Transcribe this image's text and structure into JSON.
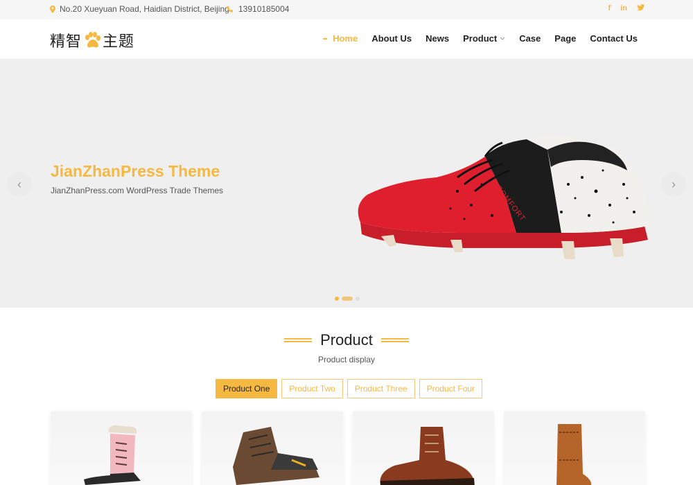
{
  "topbar": {
    "address": "No.20 Xueyuan Road, Haidian District, Beijing",
    "phone": "13910185004",
    "social": [
      "f",
      "in",
      "t"
    ]
  },
  "header": {
    "logo_left": "精智",
    "logo_right": "主题",
    "nav": [
      {
        "label": "Home",
        "active": true
      },
      {
        "label": "About Us"
      },
      {
        "label": "News"
      },
      {
        "label": "Product",
        "dropdown": true
      },
      {
        "label": "Case"
      },
      {
        "label": "Page"
      },
      {
        "label": "Contact Us"
      }
    ]
  },
  "slider": {
    "title": "JianZhanPress Theme",
    "subtitle": "JianZhanPress.com WordPress Trade Themes",
    "shoe_brand": "COMFORT",
    "prev_icon": "‹",
    "next_icon": "›",
    "slide_count": 3,
    "active_slide": 1
  },
  "product": {
    "title": "Product",
    "subtitle": "Product display",
    "tabs": [
      "Product One",
      "Product Two",
      "Product Three",
      "Product Four"
    ],
    "active_tab": 0
  },
  "colors": {
    "accent": "#f5b841",
    "text": "#222222",
    "muted": "#555555",
    "slider_bg": "#efefef"
  }
}
